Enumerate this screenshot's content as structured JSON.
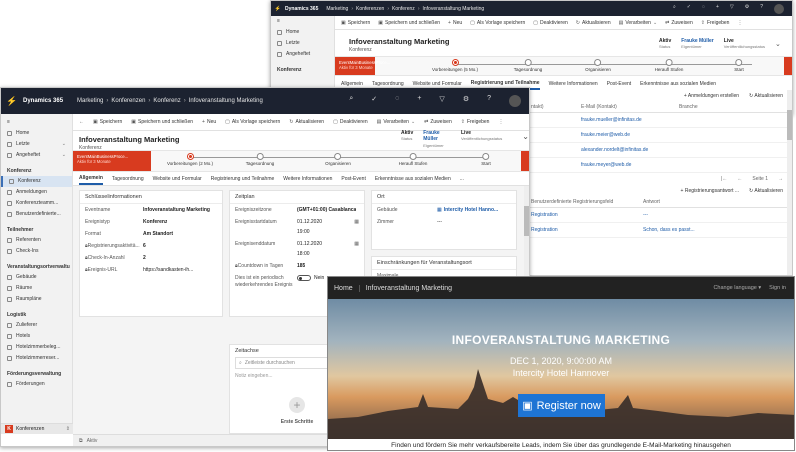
{
  "shared": {
    "app_name": "Dynamics 365",
    "breadcrumb": [
      "Marketing",
      "Konferenzen",
      "Konferenz",
      "Infoveranstaltung Marketing"
    ],
    "commands": [
      "Speichern",
      "Speichern und schließen",
      "Neu",
      "Als Vorlage speichern",
      "Deaktivieren",
      "Aktualisieren",
      "Verarbeiten",
      "Zuweisen",
      "Freigeben"
    ],
    "record_title": "Infoveranstaltung Marketing",
    "record_entity": "Konferenz",
    "header_fields": [
      {
        "value": "Aktiv",
        "label": "Status"
      },
      {
        "value": "Frauke Müller",
        "label": "Eigentümer"
      },
      {
        "value": "Live",
        "label": "Veröffentlichungsstatus"
      }
    ],
    "bpf_flag_title": "EventMainBusinessProce...",
    "bpf_flag_sub": "Aktiv für 3 Monate",
    "stages_back": [
      "Vorbereitungen (5 Mo.)",
      "Tagesordnung",
      "Organisieren",
      "Heraufl Stufen",
      "Start"
    ],
    "stages_front": [
      "Vorbereitungen (2 Mo.)",
      "Tagesordnung",
      "Organisieren",
      "Heraufl Stufen",
      "Start"
    ],
    "nav_items_top": [
      "Home",
      "Letzte",
      "Angeheftet"
    ],
    "nav_group_konferenz": "Konferenz",
    "nav_konferenz": [
      "Konferenz",
      "Anmeldungen",
      "Konferenzteamm...",
      "Benutzerdefinierte..."
    ],
    "nav_group_teilnehmer": "Teilnehmer",
    "nav_teilnehmer": [
      "Referenten",
      "Check-Ins"
    ],
    "nav_group_venue": "Veranstaltungsortverwaltu",
    "nav_venue": [
      "Gebäude",
      "Räume",
      "Raumpläne"
    ],
    "nav_group_logistik": "Logistik",
    "nav_logistik": [
      "Zulieferer",
      "Hotels",
      "Hotelzimmerbeleg...",
      "Hotelzimmerreser..."
    ],
    "nav_group_foerder": "Förderungsverwaltung",
    "nav_foerder": [
      "Förderungen"
    ],
    "area_switch": "Konferenzen",
    "area_badge": "K"
  },
  "back": {
    "tabs": [
      "Allgemein",
      "Tagesordnung",
      "Website und Formular",
      "Registrierung und Teilnahme",
      "Weitere Informationen",
      "Post-Event",
      "Erkenntnisse aus sozialen Medien"
    ],
    "nav_group": "Konferenz",
    "subgrid1_cmds": [
      "Anmeldungen erstellen",
      "Aktualisieren"
    ],
    "subgrid1_headers": [
      "E-Mail (Kontakt)",
      "Branche"
    ],
    "subgrid1_prefix": "ntakt)",
    "subgrid1_rows": [
      "frauke.mueller@infinitas.de",
      "frauke.meier@web.de",
      "alexander.nordelt@infinitas.de",
      "frauke.meyer@web.de"
    ],
    "pager": "Seite 1",
    "subgrid2_cmds": [
      "Registrierungsantwort ...",
      "Aktualisieren"
    ],
    "subgrid2_headers": [
      "Benutzerdefinierte Registrierungsfeld",
      "Antwort"
    ],
    "subgrid2_rows": [
      [
        "Registration",
        "---"
      ],
      [
        "Registration",
        "Schon, dass es passt..."
      ]
    ]
  },
  "front": {
    "tabs": [
      "Allgemein",
      "Tagesordnung",
      "Website und Formular",
      "Registrierung und Teilnahme",
      "Weitere Informationen",
      "Post-Event",
      "Erkenntnisse aus sozialen Medien",
      "..."
    ],
    "key_info": {
      "title": "Schlüsselinformationen",
      "rows": [
        [
          "Eventname",
          "Infoveranstaltung Marketing"
        ],
        [
          "Ereignistyp",
          "Konferenz"
        ],
        [
          "Format",
          "Am Standort"
        ],
        [
          "Registrierungsaktivitä...",
          "6"
        ],
        [
          "Check-In-Anzahl",
          "2"
        ],
        [
          "Ereignis-URL",
          "https://sandkasten-ih..."
        ]
      ]
    },
    "timeline": {
      "title": "Zeitplan",
      "tz_label": "Ereigniszeitzone",
      "tz": "(GMT+01:00) Casablanca",
      "start_label": "Ereignisstartdatum",
      "start_date": "01.12.2020",
      "start_time": "19:00",
      "end_label": "Ereignisenddatum",
      "end_date": "01.12.2020",
      "end_time": "18:00",
      "countdown_label": "Countdown in Tagen",
      "countdown": "185",
      "recurring_label": "Dies ist ein periodisch wiederkehrendes Ereignis",
      "recurring_value": "Nein"
    },
    "location": {
      "title": "Ort",
      "building_label": "Gebäude",
      "building": "Intercity Hotel Hanno...",
      "room_label": "Zimmer",
      "room": "---"
    },
    "limits": {
      "title": "Einschränkungen für Veranstaltungsort",
      "max_label": "Maximale"
    },
    "notes": {
      "title": "Zeitachse",
      "search": "Zeitleiste durchsuchen",
      "placeholder": "Notiz eingeben...",
      "footer": "Erste Schritte"
    },
    "status_bar": "Aktiv"
  },
  "web": {
    "home": "Home",
    "title": "Infoveranstaltung Marketing",
    "change_language": "Change language",
    "sign_in": "Sign in",
    "hero_title": "INFOVERANSTALTUNG MARKETING",
    "hero_date": "DEC 1, 2020, 9:00:00 AM",
    "hero_venue": "Intercity Hotel Hannover",
    "register": "Register now",
    "footer_text": "Finden und fördern Sie mehr verkaufsbereite Leads, indem Sie über das grundlegende E-Mail-Marketing hinausgehen"
  },
  "colors": {
    "topbar": "#1c2230",
    "accent": "#1e5ca8",
    "bpf_flag": "#d83b1f",
    "register": "#1e74d4"
  }
}
